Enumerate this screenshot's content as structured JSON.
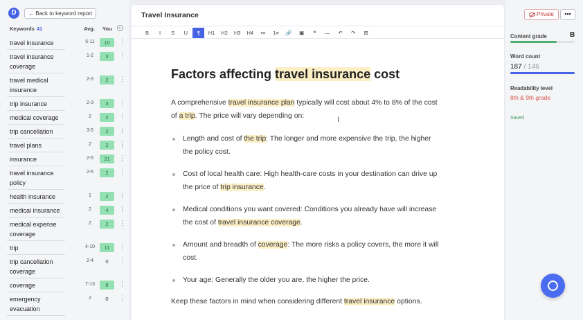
{
  "app": {
    "logo_letter": "D"
  },
  "left_panel": {
    "back_label": "Back to keyword report",
    "keywords_label": "Keywords",
    "keywords_count": "41",
    "avg_label": "Avg.",
    "you_label": "You",
    "keywords": [
      {
        "name": "travel insurance",
        "avg": "5-11",
        "you": "10"
      },
      {
        "name": "travel insurance coverage",
        "avg": "1-2",
        "you": "3"
      },
      {
        "name": "travel medical insurance",
        "avg": "2-3",
        "you": "2"
      },
      {
        "name": "trip insurance",
        "avg": "2-3",
        "you": "3"
      },
      {
        "name": "medical coverage",
        "avg": "2",
        "you": "2"
      },
      {
        "name": "trip cancellation",
        "avg": "3-5",
        "you": "2"
      },
      {
        "name": "travel plans",
        "avg": "2",
        "you": "2"
      },
      {
        "name": "insurance",
        "avg": "2-5",
        "you": "21"
      },
      {
        "name": "travel insurance policy",
        "avg": "2-5",
        "you": "2"
      },
      {
        "name": "health insurance",
        "avg": "1",
        "you": "2"
      },
      {
        "name": "medical insurance",
        "avg": "2",
        "you": "4"
      },
      {
        "name": "medical expense coverage",
        "avg": "2",
        "you": "2"
      },
      {
        "name": "trip",
        "avg": "4-10",
        "you": "11"
      },
      {
        "name": "trip cancellation coverage",
        "avg": "2-4",
        "you": "0"
      },
      {
        "name": "coverage",
        "avg": "7-13",
        "you": "8"
      },
      {
        "name": "emergency evacuation",
        "avg": "2",
        "you": "0"
      }
    ]
  },
  "editor": {
    "doc_title": "Travel Insurance",
    "toolbar": [
      "B",
      "I",
      "S",
      "U",
      "¶",
      "H1",
      "H2",
      "H3",
      "H4",
      "•≡",
      "1≡",
      "🔗",
      "▣",
      "❝",
      "—",
      "↶",
      "↷",
      "⊞"
    ],
    "heading": {
      "pre": "Factors affecting ",
      "hl": "travel insurance",
      "post": " cost"
    },
    "intro": {
      "l1_pre": "A comprehensive ",
      "l1_hl": "travel insurance plan",
      "l1_post": " typically will cost about 4% to 8% of the cost",
      "l2_pre": "of ",
      "l2_hl": "a trip",
      "l2_post": ". The price will vary depending on:"
    },
    "bullets": [
      {
        "l1_pre": "Length and cost of ",
        "l1_hl": "the trip",
        "l1_post": ": The longer and more expensive the trip, the higher",
        "l2_pre": "the policy cost.",
        "l2_hl": "",
        "l2_post": ""
      },
      {
        "l1_pre": "Cost of local health care: High health-care costs in your destination can drive up",
        "l1_hl": "",
        "l1_post": "",
        "l2_pre": "the price of ",
        "l2_hl": "trip insurance",
        "l2_post": "."
      },
      {
        "l1_pre": "Medical conditions you want covered: Conditions you already have will increase",
        "l1_hl": "",
        "l1_post": "",
        "l2_pre": "the cost of ",
        "l2_hl": "travel insurance coverage",
        "l2_post": "."
      },
      {
        "l1_pre": "Amount and breadth of ",
        "l1_hl": "coverage",
        "l1_post": ": The more risks a policy covers, the more it will",
        "l2_pre": "cost.",
        "l2_hl": "",
        "l2_post": ""
      },
      {
        "l1_pre": "Your age: Generally the older you are, the higher the price.",
        "l1_hl": "",
        "l1_post": "",
        "l2_pre": "",
        "l2_hl": "",
        "l2_post": ""
      }
    ],
    "closing": {
      "pre": "Keep these factors in mind when considering different ",
      "hl": "travel insurance",
      "post": " options."
    }
  },
  "right_panel": {
    "private_label": "Private",
    "more_label": "•••",
    "content_grade_label": "Content grade",
    "content_grade": "B",
    "content_grade_fill": 0.72,
    "word_count_label": "Word count",
    "word_count": "187",
    "word_target": "146",
    "word_count_fill": 1.0,
    "readability_label": "Readability level",
    "readability_value": "8th & 9th grade",
    "saved_label": "Saved",
    "colors": {
      "accent": "#4663e6",
      "grade_bar": "#4caf6e",
      "readability": "#d8534f"
    }
  }
}
